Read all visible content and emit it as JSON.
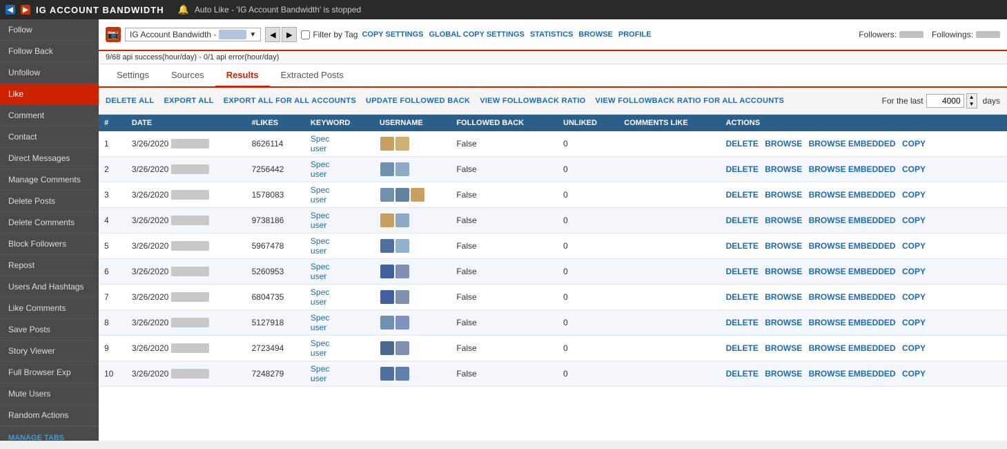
{
  "titleBar": {
    "icon1": "◀",
    "icon2": "▶",
    "title": "IG ACCOUNT BANDWIDTH",
    "bell": "🔔",
    "alertText": "Auto Like - 'IG Account Bandwidth' is stopped"
  },
  "sidebar": {
    "items": [
      {
        "label": "Follow",
        "active": false
      },
      {
        "label": "Follow Back",
        "active": false
      },
      {
        "label": "Unfollow",
        "active": false
      },
      {
        "label": "Like",
        "active": true
      },
      {
        "label": "Comment",
        "active": false
      },
      {
        "label": "Contact",
        "active": false
      },
      {
        "label": "Direct Messages",
        "active": false
      },
      {
        "label": "Manage Comments",
        "active": false
      },
      {
        "label": "Delete Posts",
        "active": false
      },
      {
        "label": "Delete Comments",
        "active": false
      },
      {
        "label": "Block Followers",
        "active": false
      },
      {
        "label": "Repost",
        "active": false
      },
      {
        "label": "Users And Hashtags",
        "active": false
      },
      {
        "label": "Like Comments",
        "active": false
      },
      {
        "label": "Save Posts",
        "active": false
      },
      {
        "label": "Story Viewer",
        "active": false
      },
      {
        "label": "Full Browser Exp",
        "active": false
      },
      {
        "label": "Mute Users",
        "active": false
      },
      {
        "label": "Random Actions",
        "active": false
      }
    ],
    "manageTabsLabel": "MANAGE TABS"
  },
  "topBar": {
    "accountName": "IG Account Bandwidth -",
    "filterByTagLabel": "Filter by Tag",
    "copySettingsLabel": "COPY SETTINGS",
    "globalCopySettingsLabel": "GLOBAL COPY SETTINGS",
    "statisticsLabel": "STATISTICS",
    "browseLabel": "BROWSE",
    "profileLabel": "PROFILE",
    "followersLabel": "Followers:",
    "followingsLabel": "Followings:"
  },
  "statusBar": {
    "text": "9/68 api success(hour/day)  -  0/1 api error(hour/day)"
  },
  "tabs": [
    {
      "label": "Settings",
      "active": false
    },
    {
      "label": "Sources",
      "active": false
    },
    {
      "label": "Results",
      "active": true
    },
    {
      "label": "Extracted Posts",
      "active": false
    }
  ],
  "actionBar": {
    "deleteAll": "DELETE ALL",
    "exportAll": "EXPORT ALL",
    "exportAllAccounts": "EXPORT ALL FOR ALL ACCOUNTS",
    "updateFollowedBack": "UPDATE FOLLOWED BACK",
    "viewFollowbackRatio": "VIEW FOLLOWBACK RATIO",
    "viewFollowbackRatioAll": "VIEW FOLLOWBACK RATIO FOR ALL ACCOUNTS",
    "forLastLabel": "For the last",
    "daysValue": "4000",
    "daysLabel": "days"
  },
  "table": {
    "columns": [
      "#",
      "DATE",
      "#LIKES",
      "KEYWORD",
      "USERNAME",
      "FOLLOWED BACK",
      "UNLIKED",
      "COMMENTS LIKE",
      "ACTIONS"
    ],
    "rows": [
      {
        "num": 1,
        "date": "3/26/2020",
        "likes": "8626114",
        "keyword": "Spec user",
        "followedBack": "False",
        "unliked": "0"
      },
      {
        "num": 2,
        "date": "3/26/2020",
        "likes": "7256442",
        "keyword": "Spec user",
        "followedBack": "False",
        "unliked": "0"
      },
      {
        "num": 3,
        "date": "3/26/2020",
        "likes": "1578083",
        "keyword": "Spec user",
        "followedBack": "False",
        "unliked": "0"
      },
      {
        "num": 4,
        "date": "3/26/2020",
        "likes": "9738186",
        "keyword": "Spec user",
        "followedBack": "False",
        "unliked": "0"
      },
      {
        "num": 5,
        "date": "3/26/2020",
        "likes": "5967478",
        "keyword": "Spec user",
        "followedBack": "False",
        "unliked": "0"
      },
      {
        "num": 6,
        "date": "3/26/2020",
        "likes": "5260953",
        "keyword": "Spec user",
        "followedBack": "False",
        "unliked": "0"
      },
      {
        "num": 7,
        "date": "3/26/2020",
        "likes": "6804735",
        "keyword": "Spec user",
        "followedBack": "False",
        "unliked": "0"
      },
      {
        "num": 8,
        "date": "3/26/2020",
        "likes": "5127918",
        "keyword": "Spec user",
        "followedBack": "False",
        "unliked": "0"
      },
      {
        "num": 9,
        "date": "3/26/2020",
        "likes": "2723494",
        "keyword": "Spec user",
        "followedBack": "False",
        "unliked": "0"
      },
      {
        "num": 10,
        "date": "3/26/2020",
        "likes": "7248279",
        "keyword": "Spec user",
        "followedBack": "False",
        "unliked": "0"
      }
    ],
    "rowActions": [
      "DELETE",
      "BROWSE",
      "BROWSE EMBEDDED",
      "COPY"
    ]
  },
  "colors": {
    "accent": "#cc2200",
    "link": "#1a6ab5",
    "headerBg": "#2a5f8a"
  }
}
